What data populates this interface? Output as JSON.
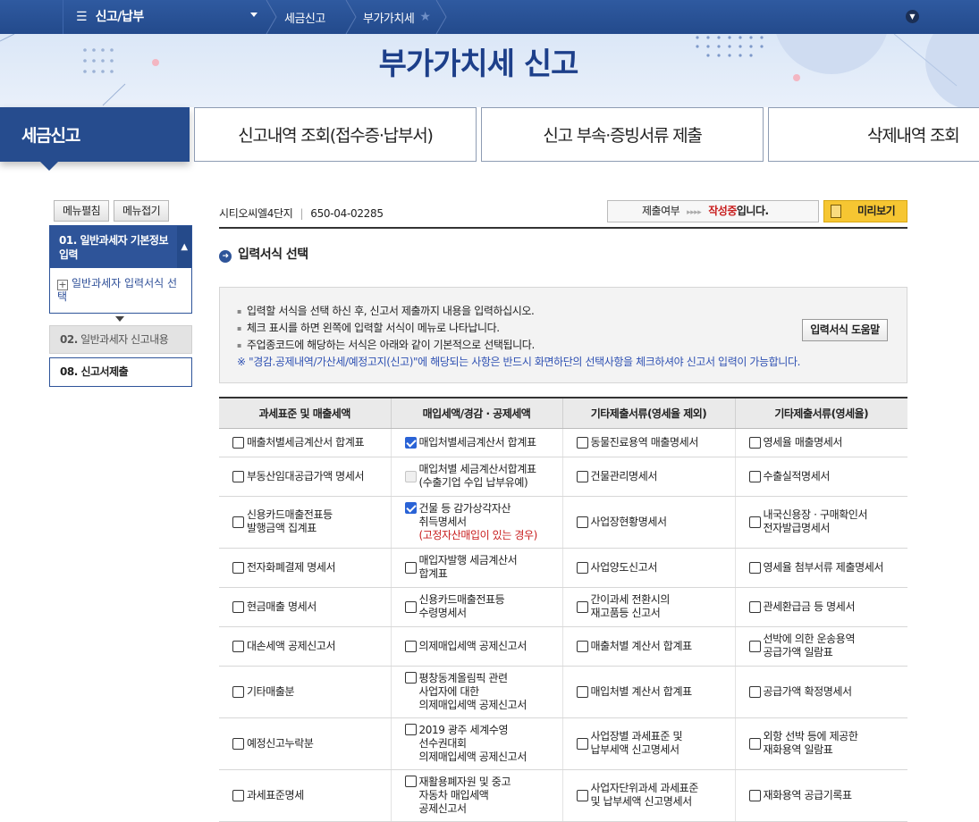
{
  "topnav": {
    "menu_label": "신고/납부",
    "breadcrumb": [
      "세금신고",
      "부가가치세"
    ]
  },
  "banner": {
    "title": "부가가치세 신고"
  },
  "tabs": [
    "세금신고",
    "신고내역 조회(접수증·납부서)",
    "신고 부속·증빙서류 제출",
    "삭제내역 조회"
  ],
  "sidebar": {
    "expand_all": "메뉴펼침",
    "collapse_all": "메뉴접기",
    "step1": {
      "num": "01.",
      "label": "일반과세자 기본정보 입력"
    },
    "step1_sub": "일반과세자 입력서식 선택",
    "step2": {
      "num": "02.",
      "label": "일반과세자 신고내용"
    },
    "step8": {
      "num": "08.",
      "label": "신고서제출"
    }
  },
  "header": {
    "company": "시티오씨엘4단지",
    "bizno": "650-04-02285",
    "status_label": "제출여부",
    "status_arrows": "▸▸▸▸",
    "status_value": "작성중",
    "status_suffix": "입니다.",
    "preview_button": "미리보기"
  },
  "section_title": "입력서식 선택",
  "info": {
    "lines": [
      "입력할 서식을 선택 하신 후, 신고서 제출까지 내용을 입력하십시오.",
      "체크 표시를 하면 왼쪽에 입력할 서식이 메뉴로 나타납니다.",
      "주업종코드에 해당하는 서식은 아래와 같이 기본적으로 선택됩니다."
    ],
    "note": "※ \"경감.공제내역/가산세/예정고지(신고)\"에 해당되는 사항은 반드시 화면하단의 선택사항을 체크하셔야 신고서 입력이 가능합니다.",
    "help_button": "입력서식 도움말"
  },
  "table": {
    "headers": [
      "과세표준 및 매출세액",
      "매입세액/경감 · 공제세액",
      "기타제출서류(영세율 제외)",
      "기타제출서류(영세율)"
    ],
    "rows": [
      {
        "c1": "매출처별세금계산서 합계표",
        "c2a": "매입처별세금계산서 합계표",
        "c2b": "",
        "c2red": "",
        "c2state": "on",
        "c3a": "동물진료용역 매출명세서",
        "c3b": "",
        "c4a": "영세율 매출명세서",
        "c4b": ""
      },
      {
        "c1": "부동산임대공급가액 명세서",
        "c2a": "매입처별 세금계산서합계표",
        "c2b": "(수출기업 수입 납부유예)",
        "c2red": "",
        "c2state": "dis",
        "c3a": "건물관리명세서",
        "c3b": "",
        "c4a": "수출실적명세서",
        "c4b": ""
      },
      {
        "c1": "신용카드매출전표등",
        "c1b": "발행금액 집계표",
        "c2a": "건물 등 감가상각자산",
        "c2b": "취득명세서",
        "c2red": "(고정자산매입이 있는 경우)",
        "c2state": "on",
        "c3a": "사업장현황명세서",
        "c3b": "",
        "c4a": "내국신용장 · 구매확인서",
        "c4b": "전자발급명세서"
      },
      {
        "c1": "전자화폐결제 명세서",
        "c2a": "매입자발행 세금계산서",
        "c2b": "합계표",
        "c2red": "",
        "c2state": "",
        "c3a": "사업양도신고서",
        "c3b": "",
        "c4a": "영세율 첨부서류 제출명세서",
        "c4b": ""
      },
      {
        "c1": "현금매출 명세서",
        "c2a": "신용카드매출전표등",
        "c2b": "수령명세서",
        "c2red": "",
        "c2state": "",
        "c3a": "간이과세 전환시의",
        "c3b": "재고품등 신고서",
        "c4a": "관세환급금 등 명세서",
        "c4b": ""
      },
      {
        "c1": "대손세액 공제신고서",
        "c2a": "의제매입세액 공제신고서",
        "c2b": "",
        "c2red": "",
        "c2state": "",
        "c3a": "매출처별 계산서 합계표",
        "c3b": "",
        "c4a": "선박에 의한 운송용역",
        "c4b": "공급가액 일람표"
      },
      {
        "c1": "기타매출분",
        "c2a": "평창동계올림픽 관련",
        "c2b": "사업자에 대한",
        "c2c": "의제매입세액 공제신고서",
        "c2red": "",
        "c2state": "",
        "c3a": "매입처별 계산서 합계표",
        "c3b": "",
        "c4a": "공급가액 확정명세서",
        "c4b": ""
      },
      {
        "c1": "예정신고누락분",
        "c2a": "2019 광주 세계수영",
        "c2b": "선수권대회",
        "c2c": "의제매입세액 공제신고서",
        "c2red": "",
        "c2state": "",
        "c3a": "사업장별 과세표준 및",
        "c3b": "납부세액 신고명세서",
        "c4a": "외항 선박 등에 제공한",
        "c4b": "재화용역 일람표"
      },
      {
        "c1": "과세표준명세",
        "c2a": "재활용폐자원 및 중고",
        "c2b": "자동차 매입세액",
        "c2c": "공제신고서",
        "c2red": "",
        "c2state": "",
        "c3a": "사업자단위과세 과세표준",
        "c3b": "및 납부세액 신고명세서",
        "c4a": "재화용역 공급기록표",
        "c4b": ""
      }
    ]
  },
  "colors": {
    "nav": "#234a8c",
    "accent": "#2e5499",
    "red": "#c81e1e",
    "note": "#2f51b3",
    "preview": "#f6c632"
  }
}
